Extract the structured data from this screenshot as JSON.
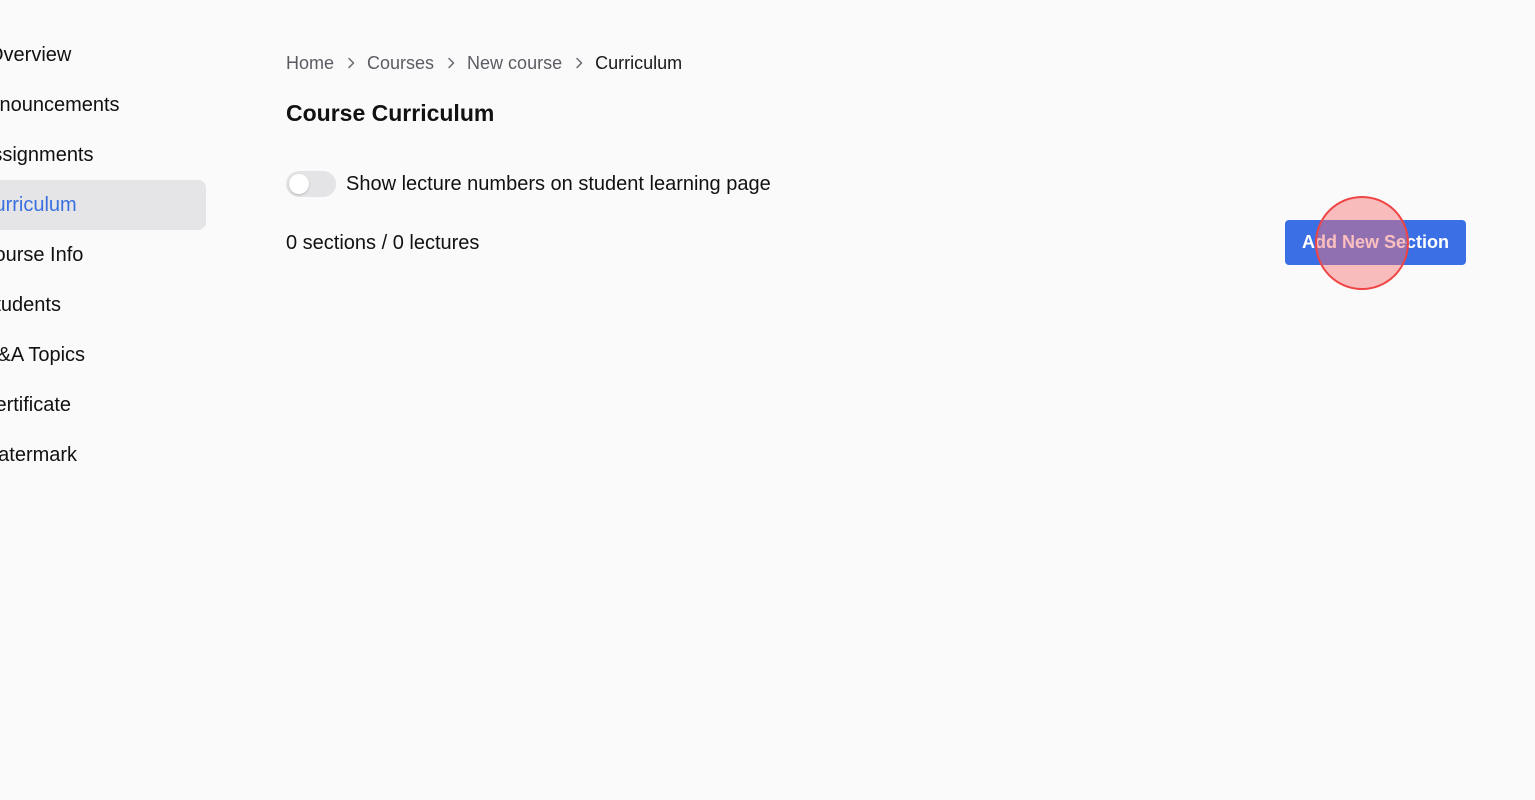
{
  "sidebar": {
    "items": [
      {
        "label": "Overview",
        "active": false
      },
      {
        "label": "Announcements",
        "active": false
      },
      {
        "label": "Assignments",
        "active": false
      },
      {
        "label": "Curriculum",
        "active": true
      },
      {
        "label": "Course Info",
        "active": false
      },
      {
        "label": "Students",
        "active": false
      },
      {
        "label": "Q&A Topics",
        "active": false
      },
      {
        "label": "Certificate",
        "active": false
      },
      {
        "label": "Watermark",
        "active": false
      }
    ]
  },
  "breadcrumb": {
    "items": [
      "Home",
      "Courses",
      "New course",
      "Curriculum"
    ],
    "separator_icon": "chevron-right-icon"
  },
  "page": {
    "title": "Course Curriculum"
  },
  "settings": {
    "show_lecture_numbers_label": "Show lecture numbers on student learning page",
    "show_lecture_numbers_enabled": false
  },
  "curriculum": {
    "counts": "0 sections / 0 lectures",
    "add_section_label": "Add New Section"
  },
  "colors": {
    "accent": "#3b6fe6",
    "active_text": "#3b6fe0",
    "active_bg": "#e5e5e7",
    "background": "#fafafa",
    "click_indicator": "#ef4444"
  }
}
